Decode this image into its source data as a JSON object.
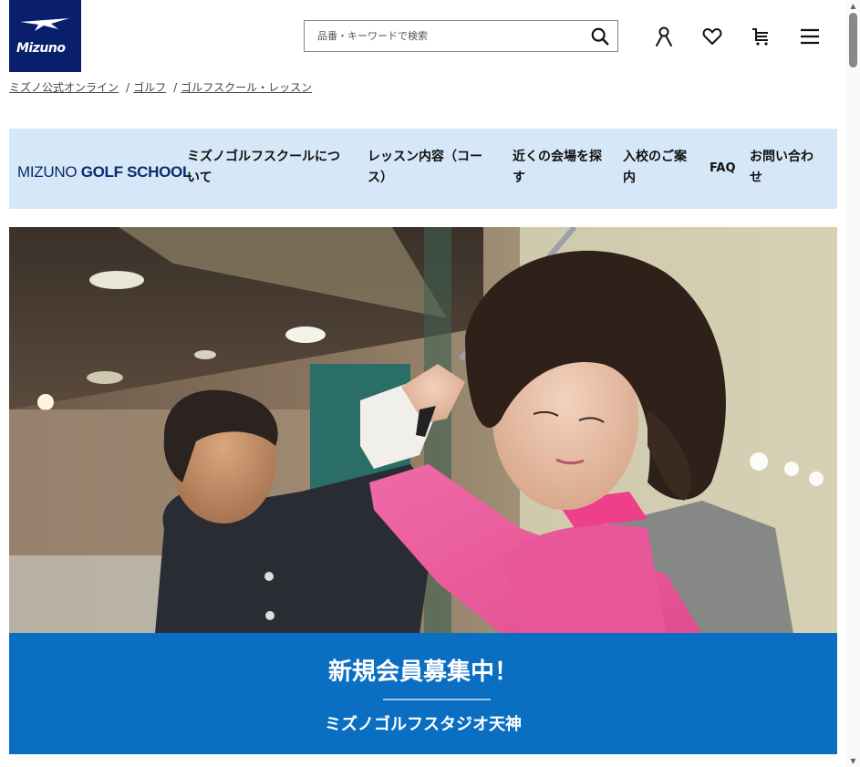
{
  "header": {
    "logo_text": "Mizuno",
    "search_placeholder": "品番・キーワードで検索",
    "icons": [
      "search-icon",
      "account-icon",
      "heart-icon",
      "cart-icon",
      "menu-icon"
    ]
  },
  "breadcrumb": [
    "ミズノ公式オンライン",
    "ゴルフ",
    "ゴルフスクール・レッスン"
  ],
  "breadcrumb_sep": "/",
  "school_nav": {
    "brand_light": "MIZUNO",
    "brand_bold": "GOLF SCHOOL",
    "items": [
      {
        "line1": "ミズノゴルフスクールにつ",
        "line2": "いて"
      },
      {
        "line1": "レッスン内容（コー",
        "line2": "ス）"
      },
      {
        "line1": "近くの会場を探",
        "line2": "す"
      },
      {
        "line1": "入校のご案",
        "line2": "内"
      },
      {
        "line1": "FAQ",
        "line2": ""
      },
      {
        "line1": "お問い合わ",
        "line2": "せ"
      }
    ]
  },
  "banner": {
    "title": "新規会員募集中！",
    "subtitle": "ミズノゴルフスタジオ天神"
  },
  "colors": {
    "brand_navy": "#0a1e6e",
    "nav_bg": "#d6e8f7",
    "banner_blue": "#0a6fc2"
  }
}
